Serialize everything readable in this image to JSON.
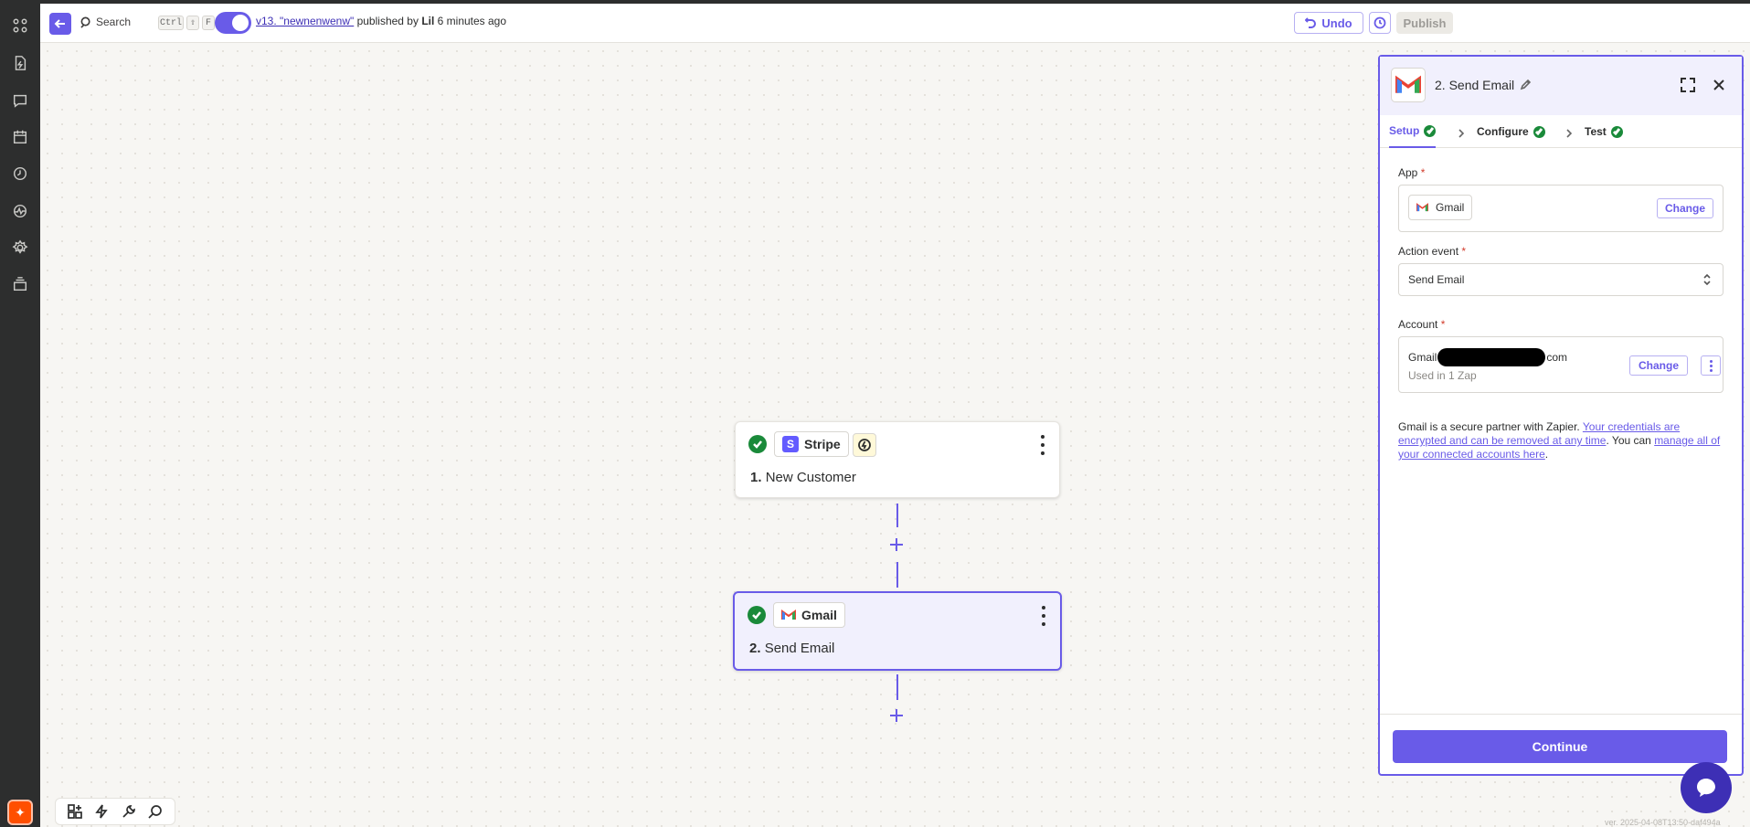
{
  "header": {
    "search_label": "Search",
    "kbd_keys": [
      "Ctrl",
      "⇧",
      "F"
    ],
    "version_link": "v13. \"newnenwenw\"",
    "published_by_text": " published by ",
    "publisher": "Lil",
    "published_ago": " 6 minutes ago",
    "undo_label": "Undo",
    "publish_label": "Publish"
  },
  "rail": {
    "icons": [
      "apps-icon",
      "zap-file-icon",
      "chat-icon",
      "calendar-icon",
      "history-icon",
      "activity-icon",
      "settings-icon",
      "layers-icon"
    ]
  },
  "canvas": {
    "nodes": [
      {
        "app": "Stripe",
        "step_number": "1.",
        "title": "New Customer",
        "status": "complete"
      },
      {
        "app": "Gmail",
        "step_number": "2.",
        "title": "Send Email",
        "status": "complete",
        "selected": true
      }
    ],
    "version_footer": "ver. 2025-04-08T13:50-daf494a"
  },
  "panel": {
    "title": "2. Send Email",
    "tabs": [
      {
        "label": "Setup",
        "active": true,
        "complete": true
      },
      {
        "label": "Configure",
        "active": false,
        "complete": true
      },
      {
        "label": "Test",
        "active": false,
        "complete": true
      }
    ],
    "app_label": "App",
    "app_value": "Gmail",
    "app_change": "Change",
    "action_event_label": "Action event",
    "action_event_value": "Send Email",
    "account_label": "Account",
    "account_prefix": "Gmail",
    "account_suffix": "com",
    "account_sub": "Used in 1 Zap",
    "account_change": "Change",
    "required_mark": "*",
    "note_pre": "Gmail is a secure partner with Zapier. ",
    "note_link1": "Your credentials are encrypted and can be removed at any time",
    "note_mid": ". You can ",
    "note_link2": "manage all of your connected accounts here",
    "note_post": ".",
    "continue_label": "Continue"
  },
  "colors": {
    "accent": "#695be8",
    "success": "#1a8a3a",
    "rail_bg": "#2d2e2e",
    "brand_orange": "#ff4f00"
  }
}
